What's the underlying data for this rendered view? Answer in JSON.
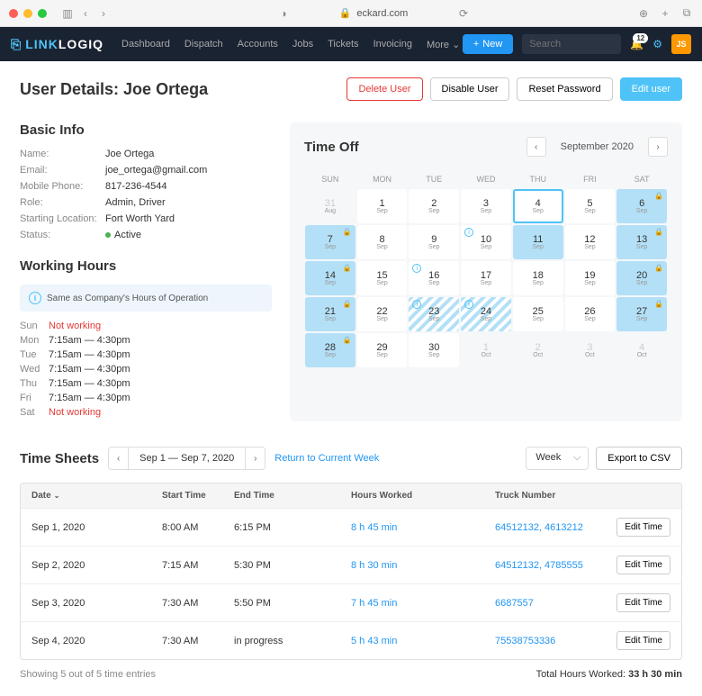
{
  "browser": {
    "url": "eckard.com"
  },
  "nav": {
    "logo_a": "LINK",
    "logo_b": "LOGIQ",
    "items": [
      "Dashboard",
      "Dispatch",
      "Accounts",
      "Jobs",
      "Tickets",
      "Invoicing",
      "More"
    ],
    "new_label": "New",
    "search_placeholder": "Search",
    "badge": "12",
    "avatar": "JS"
  },
  "page": {
    "title": "User Details: Joe Ortega"
  },
  "actions": {
    "delete": "Delete User",
    "disable": "Disable User",
    "reset": "Reset Password",
    "edit": "Edit user"
  },
  "basic": {
    "title": "Basic Info",
    "rows": [
      {
        "label": "Name:",
        "val": "Joe Ortega"
      },
      {
        "label": "Email:",
        "val": "joe_ortega@gmail.com"
      },
      {
        "label": "Mobile Phone:",
        "val": "817-236-4544"
      },
      {
        "label": "Role:",
        "val": "Admin, Driver"
      },
      {
        "label": "Starting Location:",
        "val": "Fort Worth Yard"
      },
      {
        "label": "Status:",
        "val": "Active",
        "status": true
      }
    ]
  },
  "hours": {
    "title": "Working Hours",
    "note": "Same as Company's Hours of Operation",
    "rows": [
      {
        "day": "Sun",
        "val": "Not working",
        "nw": true
      },
      {
        "day": "Mon",
        "val": "7:15am — 4:30pm"
      },
      {
        "day": "Tue",
        "val": "7:15am — 4:30pm"
      },
      {
        "day": "Wed",
        "val": "7:15am — 4:30pm"
      },
      {
        "day": "Thu",
        "val": "7:15am — 4:30pm"
      },
      {
        "day": "Fri",
        "val": "7:15am — 4:30pm"
      },
      {
        "day": "Sat",
        "val": "Not working",
        "nw": true
      }
    ]
  },
  "calendar": {
    "title": "Time Off",
    "month": "September 2020",
    "dow": [
      "SUN",
      "MON",
      "TUE",
      "WED",
      "THU",
      "FRI",
      "SAT"
    ],
    "cells": [
      {
        "d": 31,
        "m": "Aug",
        "out": true
      },
      {
        "d": 1,
        "m": "Sep"
      },
      {
        "d": 2,
        "m": "Sep"
      },
      {
        "d": 3,
        "m": "Sep"
      },
      {
        "d": 4,
        "m": "Sep",
        "today": true
      },
      {
        "d": 5,
        "m": "Sep"
      },
      {
        "d": 6,
        "m": "Sep",
        "off": true,
        "lock": true
      },
      {
        "d": 7,
        "m": "Sep",
        "off": true,
        "lock": true
      },
      {
        "d": 8,
        "m": "Sep"
      },
      {
        "d": 9,
        "m": "Sep"
      },
      {
        "d": 10,
        "m": "Sep",
        "info": true
      },
      {
        "d": 11,
        "m": "Sep",
        "off": true
      },
      {
        "d": 12,
        "m": "Sep"
      },
      {
        "d": 13,
        "m": "Sep",
        "off": true,
        "lock": true
      },
      {
        "d": 14,
        "m": "Sep",
        "off": true,
        "lock": true
      },
      {
        "d": 15,
        "m": "Sep"
      },
      {
        "d": 16,
        "m": "Sep",
        "info": true
      },
      {
        "d": 17,
        "m": "Sep"
      },
      {
        "d": 18,
        "m": "Sep"
      },
      {
        "d": 19,
        "m": "Sep"
      },
      {
        "d": 20,
        "m": "Sep",
        "off": true,
        "lock": true
      },
      {
        "d": 21,
        "m": "Sep",
        "off": true,
        "lock": true
      },
      {
        "d": 22,
        "m": "Sep"
      },
      {
        "d": 23,
        "m": "Sep",
        "striped": true,
        "info": true
      },
      {
        "d": 24,
        "m": "Sep",
        "striped": true,
        "info": true
      },
      {
        "d": 25,
        "m": "Sep"
      },
      {
        "d": 26,
        "m": "Sep"
      },
      {
        "d": 27,
        "m": "Sep",
        "off": true,
        "lock": true
      },
      {
        "d": 28,
        "m": "Sep",
        "off": true,
        "lock": true
      },
      {
        "d": 29,
        "m": "Sep"
      },
      {
        "d": 30,
        "m": "Sep"
      },
      {
        "d": 1,
        "m": "Oct",
        "out": true
      },
      {
        "d": 2,
        "m": "Oct",
        "out": true
      },
      {
        "d": 3,
        "m": "Oct",
        "out": true
      },
      {
        "d": 4,
        "m": "Oct",
        "out": true
      }
    ]
  },
  "timesheets": {
    "title": "Time Sheets",
    "range": "Sep 1 — Sep 7, 2020",
    "return": "Return to Current Week",
    "view": "Week",
    "export": "Export to CSV",
    "cols": {
      "date": "Date",
      "start": "Start Time",
      "end": "End Time",
      "hours": "Hours Worked",
      "truck": "Truck Number"
    },
    "rows": [
      {
        "date": "Sep 1, 2020",
        "start": "8:00 AM",
        "end": "6:15 PM",
        "hours": "8 h 45 min",
        "truck": "64512132, 4613212"
      },
      {
        "date": "Sep 2, 2020",
        "start": "7:15 AM",
        "end": "5:30 PM",
        "hours": "8 h 30 min",
        "truck": "64512132, 4785555"
      },
      {
        "date": "Sep 3, 2020",
        "start": "7:30 AM",
        "end": "5:50 PM",
        "hours": "7 h 45 min",
        "truck": "6687557"
      },
      {
        "date": "Sep 4, 2020",
        "start": "7:30 AM",
        "end": "in progress",
        "hours": "5 h 43 min",
        "truck": "75538753336"
      }
    ],
    "edit": "Edit Time",
    "footer_count": "Showing 5 out of 5 time entries",
    "footer_total_label": "Total Hours Worked:",
    "footer_total": "33 h 30 min"
  }
}
